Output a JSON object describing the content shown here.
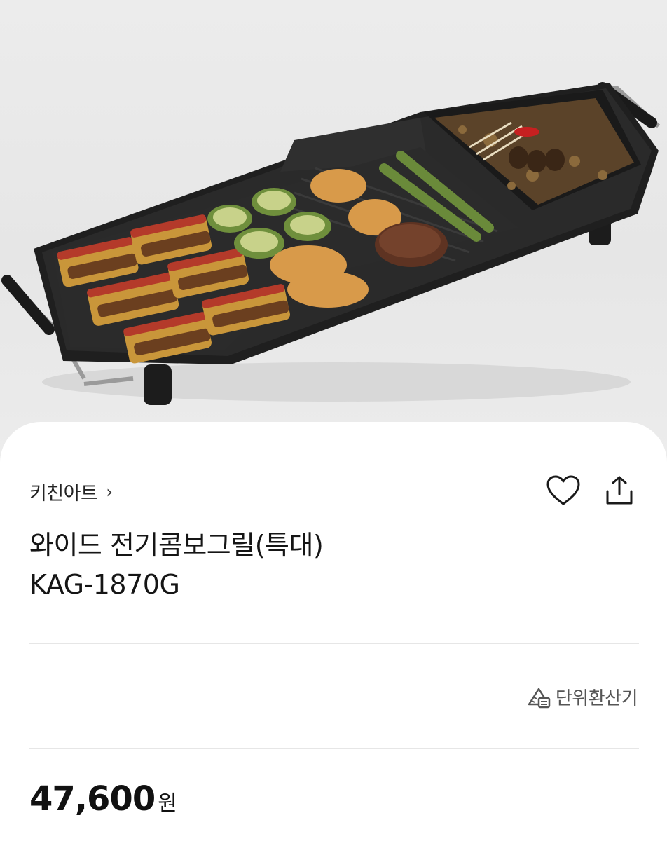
{
  "product_image": {
    "icon": "electric-grill-photo"
  },
  "brand": {
    "name": "키친아트",
    "chevron": "›"
  },
  "actions": {
    "favorite_icon": "heart-icon",
    "share_icon": "share-icon"
  },
  "product": {
    "title_line1": "와이드 전기콤보그릴(특대)",
    "title_line2": "KAG-1870G"
  },
  "unit_converter": {
    "label": "단위환산기",
    "icon": "ruler-calculator-icon"
  },
  "price": {
    "amount": "47,600",
    "currency": "원"
  }
}
